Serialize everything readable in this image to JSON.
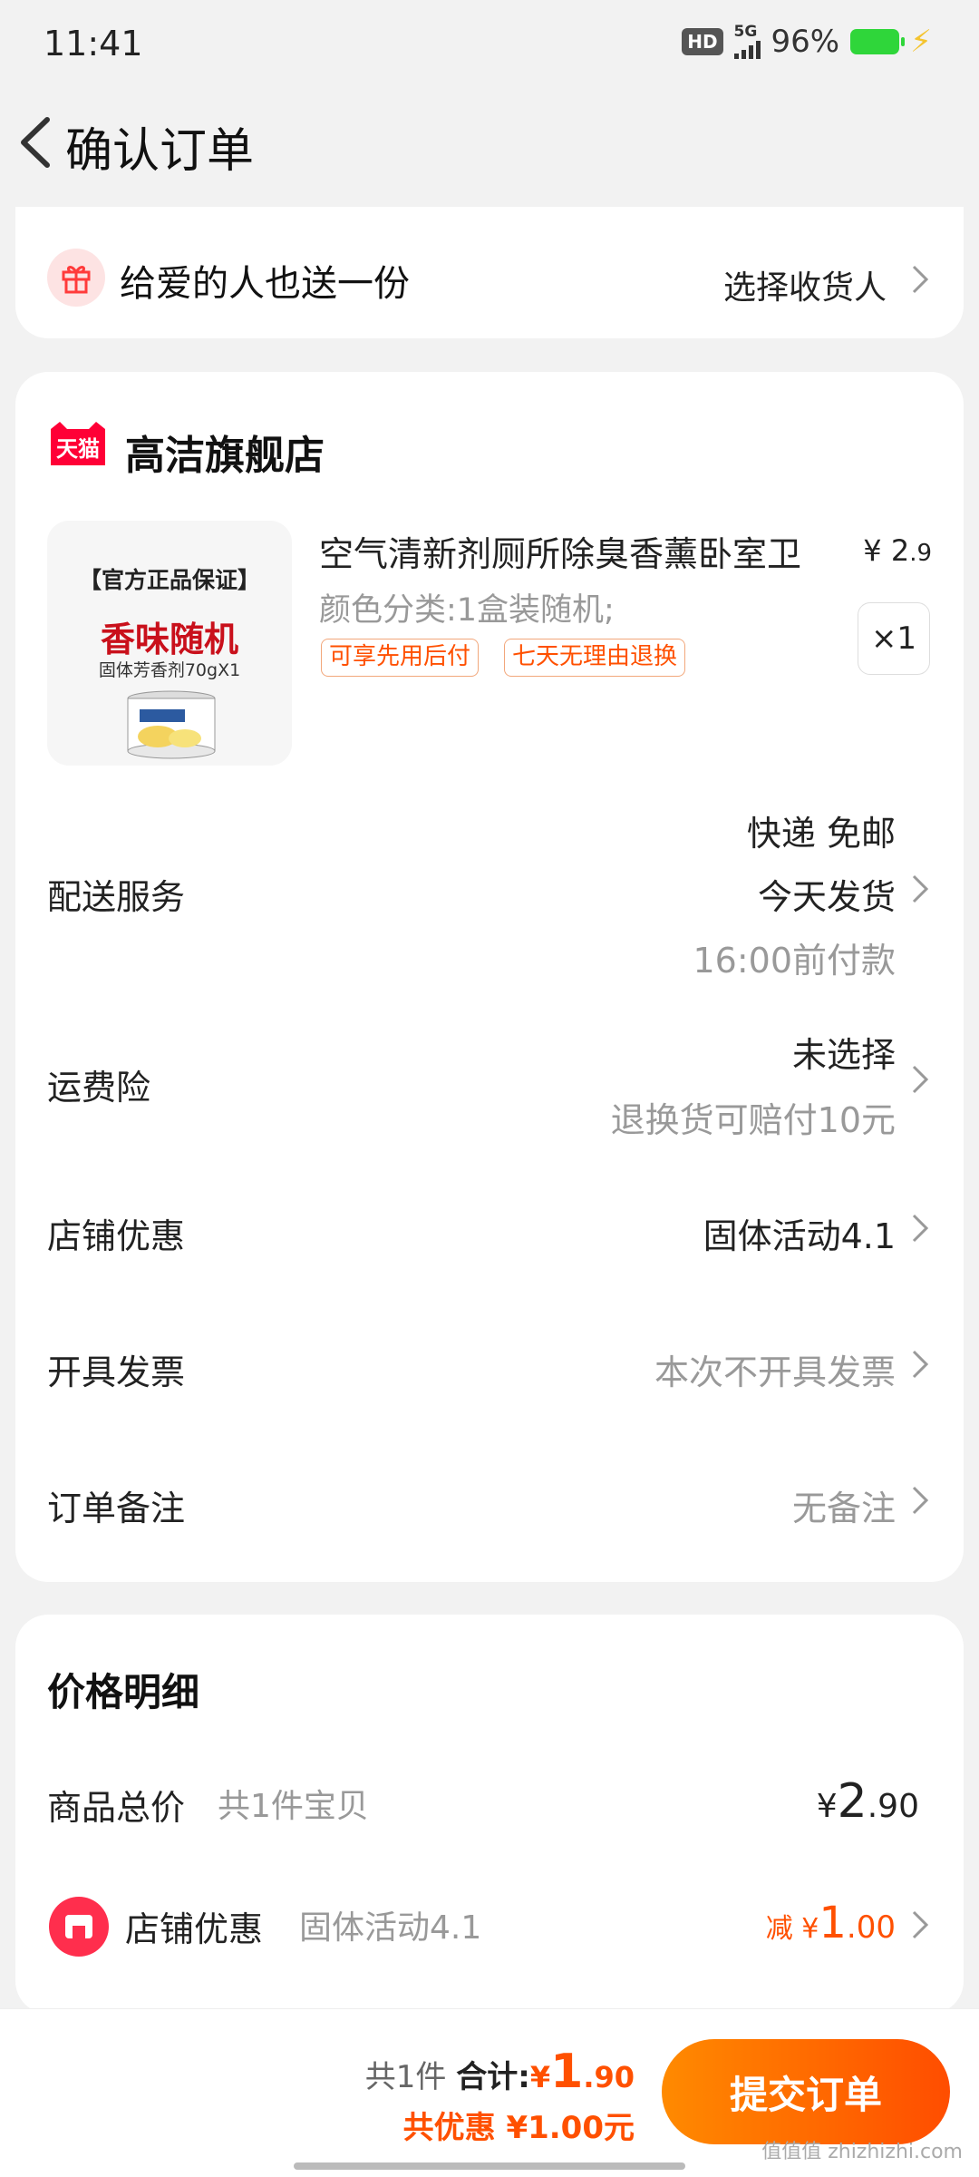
{
  "status_bar": {
    "time": "11:41",
    "hd": "HD",
    "network": "5G",
    "battery": "96%"
  },
  "header": {
    "title": "确认订单"
  },
  "gift": {
    "text": "给爱的人也送一份",
    "action": "选择收货人"
  },
  "store": {
    "badge": "天猫",
    "name": "高洁旗舰店"
  },
  "product": {
    "image_text": {
      "guarantee": "【官方正品保证】",
      "scent": "香味随机",
      "sub": "固体芳香剂70gX1"
    },
    "title": "空气清新剂厕所除臭香薰卧室卫",
    "price_int": "2",
    "price_dec": ".9",
    "currency": "¥",
    "spec": "颜色分类:1盒装随机;",
    "tags": [
      "可享先用后付",
      "七天无理由退换"
    ],
    "quantity": "×1"
  },
  "rows": {
    "delivery": {
      "label": "配送服务",
      "line1": "快递 免邮",
      "line2": "今天发货",
      "line3": "16:00前付款"
    },
    "insurance": {
      "label": "运费险",
      "line1": "未选择",
      "line2": "退换货可赔付10元"
    },
    "store_discount": {
      "label": "店铺优惠",
      "value": "固体活动4.1"
    },
    "invoice": {
      "label": "开具发票",
      "value": "本次不开具发票"
    },
    "note": {
      "label": "订单备注",
      "value": "无备注"
    }
  },
  "price_detail": {
    "title": "价格明细",
    "goods_label": "商品总价",
    "goods_note": "共1件宝贝",
    "goods_currency": "¥",
    "goods_int": "2",
    "goods_dec": ".90",
    "discount_label": "店铺优惠",
    "discount_note": "固体活动4.1",
    "discount_prefix": "减",
    "discount_currency": "¥",
    "discount_int": "1",
    "discount_dec": ".00"
  },
  "bottom_bar": {
    "count": "共1件",
    "total_label": "合计:",
    "total_currency": "¥",
    "total_int": "1",
    "total_dec": ".90",
    "saved": "共优惠 ¥1.00元",
    "submit": "提交订单"
  },
  "watermark": "值值值 zhizhizhi.com"
}
